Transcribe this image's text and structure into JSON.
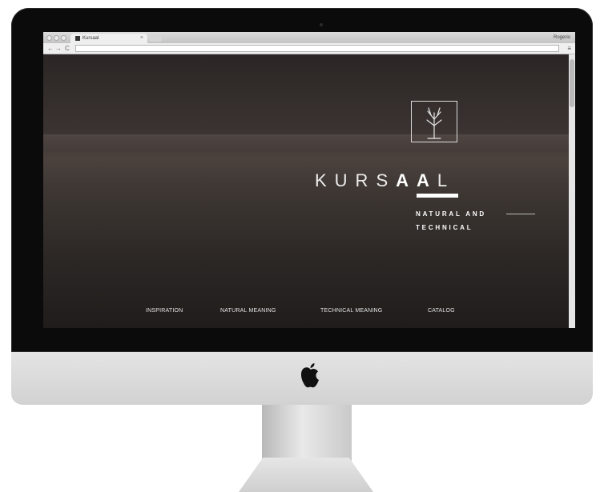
{
  "browser": {
    "tab_title": "Kursaal",
    "tab_close": "×",
    "profile_name": "Rogerio",
    "back": "←",
    "forward": "→",
    "reload": "C",
    "url": "",
    "menu": "≡"
  },
  "site": {
    "brand_light": "KURS",
    "brand_bold": "AA",
    "brand_end": "L",
    "tagline_line1": "NATURAL AND",
    "tagline_line2": "TECHNICAL",
    "nav": [
      {
        "label": "INSPIRATION"
      },
      {
        "label": "NATURAL MEANING"
      },
      {
        "label": "TECHNICAL MEANING"
      },
      {
        "label": "CATALOG"
      }
    ]
  },
  "colors": {
    "frame": "#0b0b0b",
    "chin": "#dcdcdc",
    "page_dark": "#2c2726",
    "text_light": "#ececec"
  }
}
